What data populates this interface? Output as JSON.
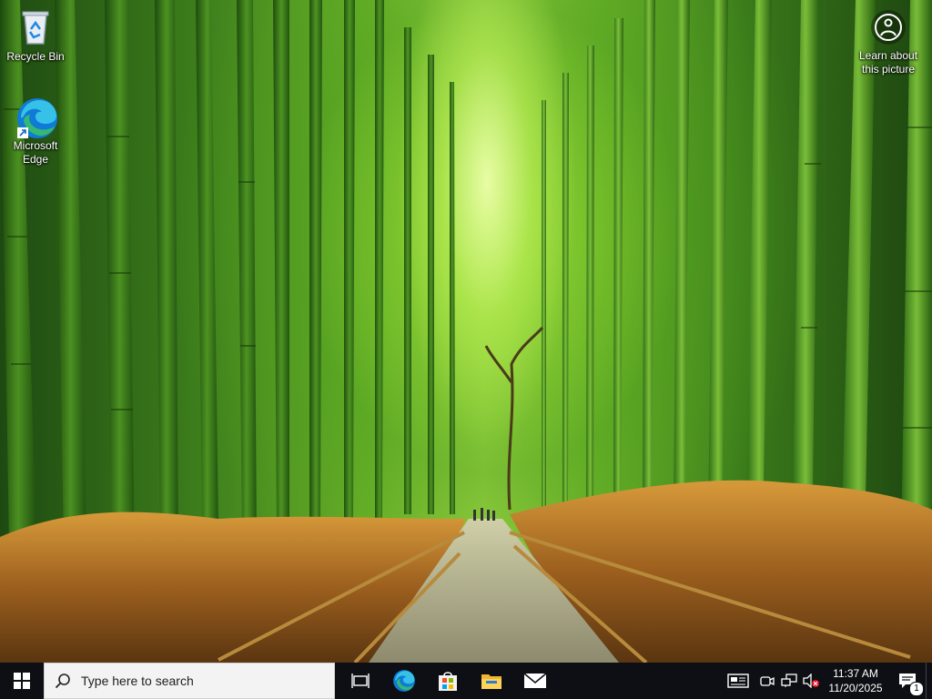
{
  "desktop": {
    "icons": [
      {
        "label": "Recycle Bin",
        "icon": "recycle-bin-icon"
      },
      {
        "label": "Microsoft Edge",
        "icon": "edge-icon"
      }
    ],
    "learn_about_picture": {
      "label": "Learn about this picture",
      "icon": "camera-info-icon"
    }
  },
  "taskbar": {
    "start_icon": "windows-logo-icon",
    "search_placeholder": "Type here to search",
    "apps": [
      {
        "name": "Task View",
        "icon": "task-view-icon"
      },
      {
        "name": "Microsoft Edge",
        "icon": "edge-icon"
      },
      {
        "name": "Microsoft Store",
        "icon": "store-icon"
      },
      {
        "name": "File Explorer",
        "icon": "folder-icon"
      },
      {
        "name": "Mail",
        "icon": "mail-icon"
      }
    ],
    "tray": {
      "icons": [
        "news-widget-icon",
        "meet-now-icon",
        "network-icon",
        "volume-muted-icon"
      ],
      "time": "11:37 AM",
      "date": "11/20/2025",
      "notification_count": "1"
    }
  },
  "colors": {
    "taskbar_bg": "#0d0f14",
    "search_bg": "#f3f3f3",
    "accent": "#0078d4"
  }
}
